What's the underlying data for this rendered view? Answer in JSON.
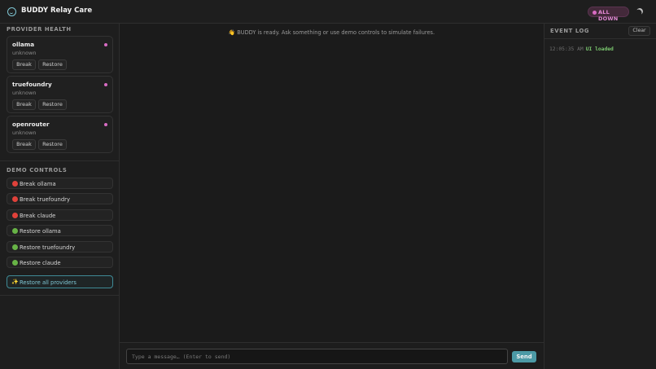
{
  "app": {
    "title": "BUDDY Relay Care",
    "logo_icon": "smile-circle-icon"
  },
  "status": {
    "label": "ALL DOWN",
    "color": "#d86bc3"
  },
  "theme_toggle": {
    "icon": "moon-icon"
  },
  "sidebar": {
    "provider_health_title": "PROVIDER HEALTH",
    "providers": [
      {
        "name": "ollama",
        "status": "unknown",
        "break_label": "Break",
        "restore_label": "Restore"
      },
      {
        "name": "truefoundry",
        "status": "unknown",
        "break_label": "Break",
        "restore_label": "Restore"
      },
      {
        "name": "openrouter",
        "status": "unknown",
        "break_label": "Break",
        "restore_label": "Restore"
      }
    ],
    "demo_controls_title": "DEMO CONTROLS",
    "demo_buttons": [
      {
        "label": "Break ollama",
        "icon": "red-circle-icon"
      },
      {
        "label": "Break truefoundry",
        "icon": "red-circle-icon"
      },
      {
        "label": "Break claude",
        "icon": "red-circle-icon"
      },
      {
        "label": "Restore ollama",
        "icon": "green-circle-icon"
      },
      {
        "label": "Restore truefoundry",
        "icon": "green-circle-icon"
      },
      {
        "label": "Restore claude",
        "icon": "green-circle-icon"
      }
    ],
    "restore_all": {
      "label": "Restore all providers",
      "icon": "sparkles-icon"
    }
  },
  "chat": {
    "ready_message": "👋 BUDDY is ready. Ask something or use demo controls to simulate failures.",
    "input_placeholder": "Type a message… (Enter to send)",
    "send_label": "Send"
  },
  "event_log": {
    "title": "EVENT LOG",
    "clear_label": "Clear",
    "entries": [
      {
        "time": "12:05:35 AM",
        "message": "UI loaded"
      }
    ]
  }
}
